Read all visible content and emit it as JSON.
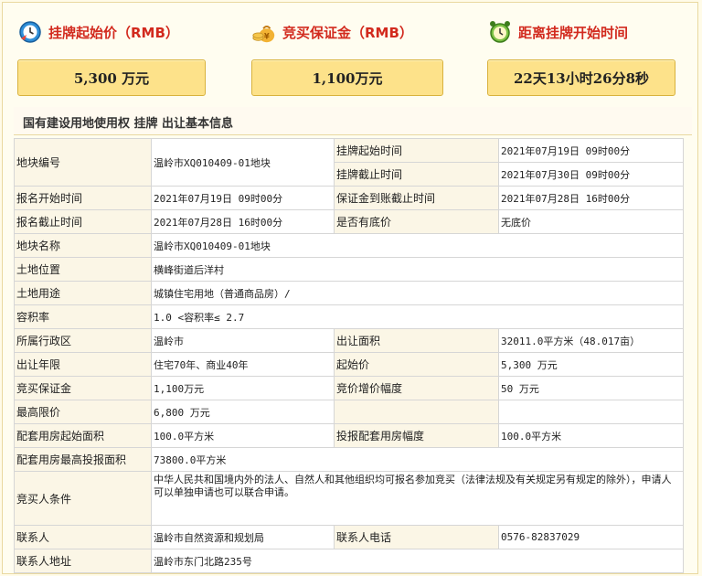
{
  "cards": [
    {
      "title": "挂牌起始价（RMB）",
      "value": "5,300  万元",
      "icon": "clock-icon"
    },
    {
      "title": "竞买保证金（RMB）",
      "value": "1,100万元",
      "icon": "money-bag-icon"
    },
    {
      "title": "距离挂牌开始时间",
      "value": "22天13小时26分8秒",
      "icon": "alarm-clock-icon"
    }
  ],
  "section_title": "国有建设用地使用权  挂牌  出让基本信息",
  "table": {
    "r1": {
      "l1": "地块编号",
      "v1": "温岭市XQ010409-01地块",
      "l2a": "挂牌起始时间",
      "v2a": "2021年07月19日  09时00分",
      "l2b": "挂牌截止时间",
      "v2b": "2021年07月30日  09时00分"
    },
    "r2": {
      "l1": "报名开始时间",
      "v1": "2021年07月19日  09时00分",
      "l2": "保证金到账截止时间",
      "v2": "2021年07月28日  16时00分"
    },
    "r3": {
      "l1": "报名截止时间",
      "v1": "2021年07月28日  16时00分",
      "l2": "是否有底价",
      "v2": "无底价"
    },
    "r4": {
      "l": "地块名称",
      "v": "温岭市XQ010409-01地块"
    },
    "r5": {
      "l": "土地位置",
      "v": "横峰街道后洋村"
    },
    "r6": {
      "l": "土地用途",
      "v": "城镇住宅用地（普通商品房）/"
    },
    "r7": {
      "l": "容积率",
      "v": "1.0 <容积率≤ 2.7"
    },
    "r8": {
      "l1": "所属行政区",
      "v1": "温岭市",
      "l2": "出让面积",
      "v2": "32011.0平方米（48.017亩）"
    },
    "r9": {
      "l1": "出让年限",
      "v1": "住宅70年、商业40年",
      "l2": "起始价",
      "v2": "5,300 万元"
    },
    "r10": {
      "l1": "竞买保证金",
      "v1": "1,100万元",
      "l2": "竞价增价幅度",
      "v2": "50 万元"
    },
    "r11": {
      "l1": "最高限价",
      "v1": "6,800 万元",
      "l2": "",
      "v2": ""
    },
    "r12": {
      "l1": "配套用房起始面积",
      "v1": "100.0平方米",
      "l2": "投报配套用房幅度",
      "v2": "100.0平方米"
    },
    "r13": {
      "l": "配套用房最高投报面积",
      "v": "73800.0平方米"
    },
    "r14": {
      "l": "竞买人条件",
      "v": "中华人民共和国境内外的法人、自然人和其他组织均可报名参加竞买（法律法规及有关规定另有规定的除外），申请人可以单独申请也可以联合申请。"
    },
    "r15": {
      "l1": "联系人",
      "v1": "温岭市自然资源和规划局",
      "l2": "联系人电话",
      "v2": "0576-82837029"
    },
    "r16": {
      "l": "联系人地址",
      "v": "温岭市东门北路235号"
    }
  }
}
